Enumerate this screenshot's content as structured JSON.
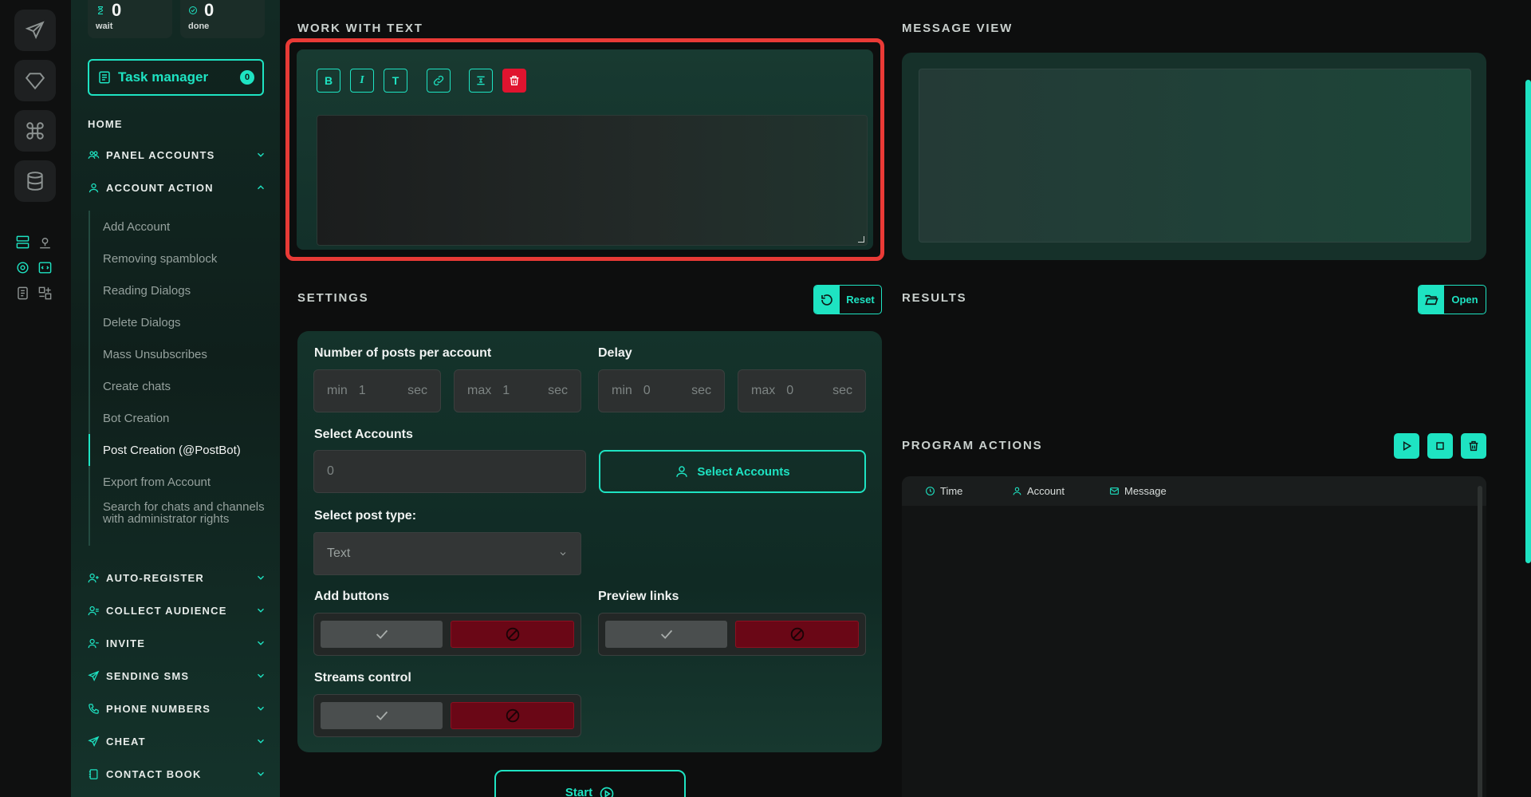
{
  "stats": [
    {
      "value": "0",
      "label": "wait",
      "icon": "hourglass-icon"
    },
    {
      "value": "0",
      "label": "done",
      "icon": "check-circle-icon"
    }
  ],
  "task_manager": {
    "label": "Task manager",
    "count": "0"
  },
  "nav": {
    "home": "HOME",
    "sections_top": [
      {
        "label": "PANEL ACCOUNTS",
        "expanded": false
      },
      {
        "label": "ACCOUNT ACTION",
        "expanded": true
      }
    ],
    "account_action_items": [
      "Add Account",
      "Removing spamblock",
      "Reading Dialogs",
      "Delete Dialogs",
      "Mass Unsubscribes",
      "Create chats",
      "Bot Creation",
      "Post Creation (@PostBot)",
      "Export from Account",
      "Search for chats and channels with administrator rights"
    ],
    "active_item": "Post Creation (@PostBot)",
    "sections_bottom": [
      {
        "label": "AUTO-REGISTER"
      },
      {
        "label": "COLLECT AUDIENCE"
      },
      {
        "label": "INVITE"
      },
      {
        "label": "SENDING SMS"
      },
      {
        "label": "PHONE NUMBERS"
      },
      {
        "label": "CHEAT"
      },
      {
        "label": "CONTACT BOOK"
      }
    ]
  },
  "work_with_text": {
    "title": "WORK WITH TEXT",
    "toolbar": {
      "bold": "B",
      "italic": "I",
      "text": "T"
    },
    "content": ""
  },
  "message_view": {
    "title": "MESSAGE VIEW"
  },
  "settings": {
    "title": "SETTINGS",
    "reset_label": "Reset",
    "posts_label": "Number of posts per account",
    "delay_label": "Delay",
    "min_prefix": "min",
    "max_prefix": "max",
    "unit": "sec",
    "posts_min": "1",
    "posts_max": "1",
    "delay_min": "0",
    "delay_max": "0",
    "select_accounts_label": "Select Accounts",
    "selected_accounts_count": "0",
    "select_accounts_button": "Select Accounts",
    "post_type_label": "Select post type:",
    "post_type_value": "Text",
    "add_buttons_label": "Add buttons",
    "preview_links_label": "Preview links",
    "streams_control_label": "Streams control",
    "start_label": "Start"
  },
  "results": {
    "title": "RESULTS",
    "open_label": "Open"
  },
  "program_actions": {
    "title": "PROGRAM ACTIONS",
    "columns": [
      "Time",
      "Account",
      "Message"
    ]
  },
  "colors": {
    "accent": "#1ee3c2",
    "danger": "#e0142f",
    "highlight": "#ea3a36"
  }
}
